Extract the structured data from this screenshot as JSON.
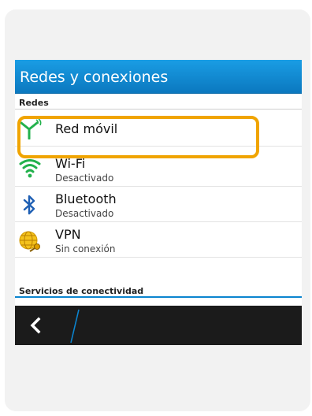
{
  "header": {
    "title": "Redes y conexiones"
  },
  "sections": {
    "redes": "Redes",
    "servicios": "Servicios de conectividad"
  },
  "items": [
    {
      "name": "Red móvil",
      "status": "",
      "icon": "antenna-icon"
    },
    {
      "name": "Wi-Fi",
      "status": "Desactivado",
      "icon": "wifi-icon"
    },
    {
      "name": "Bluetooth",
      "status": "Desactivado",
      "icon": "bluetooth-icon"
    },
    {
      "name": "VPN",
      "status": "Sin conexión",
      "icon": "vpn-globe-key-icon"
    }
  ],
  "colors": {
    "accent": "#0b84cf",
    "highlight": "#f0a400",
    "bottom_bar": "#1b1b1b"
  },
  "bottom_bar": {
    "back_icon": "back-chevron-icon"
  }
}
